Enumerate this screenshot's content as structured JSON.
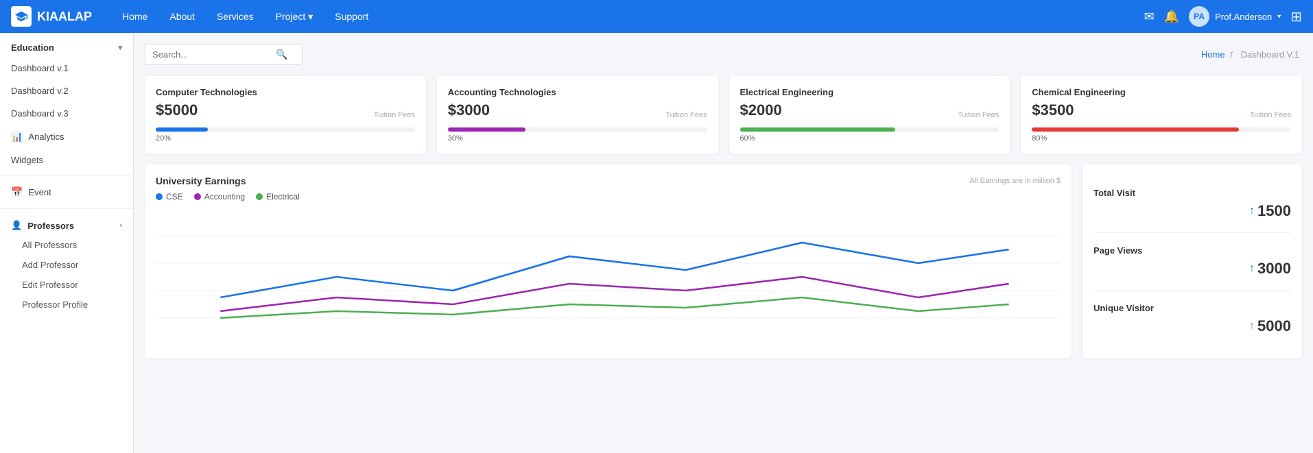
{
  "topnav": {
    "brand": "KIAALAP",
    "links": [
      "Home",
      "About",
      "Services",
      "Project",
      "Support"
    ],
    "project_has_dropdown": true,
    "user_name": "Prof.Anderson",
    "icons": {
      "mail": "✉",
      "bell": "🔔",
      "grid": "⊞"
    }
  },
  "sidebar": {
    "education_label": "Education",
    "items": [
      {
        "label": "Dashboard v.1",
        "active": false
      },
      {
        "label": "Dashboard v.2",
        "active": false
      },
      {
        "label": "Dashboard v.3",
        "active": false
      },
      {
        "label": "Analytics",
        "icon": "📊",
        "active": false
      },
      {
        "label": "Widgets",
        "active": false
      },
      {
        "label": "Event",
        "icon": "📅",
        "active": false
      }
    ],
    "professors_label": "Professors",
    "professor_sub_items": [
      "All Professors",
      "Add Professor",
      "Edit Professor",
      "Professor Profile"
    ]
  },
  "search": {
    "placeholder": "Search...",
    "icon": "🔍"
  },
  "breadcrumb": {
    "home": "Home",
    "current": "Dashboard V.1"
  },
  "stat_cards": [
    {
      "title": "Computer Technologies",
      "amount": "$5000",
      "label": "Tuition Fees",
      "pct": 20,
      "pct_text": "20%",
      "color": "#1a73e8"
    },
    {
      "title": "Accounting Technologies",
      "amount": "$3000",
      "label": "Tuition Fees",
      "pct": 30,
      "pct_text": "30%",
      "color": "#9c27b0"
    },
    {
      "title": "Electrical Engineering",
      "amount": "$2000",
      "label": "Tuition Fees",
      "pct": 60,
      "pct_text": "60%",
      "color": "#4caf50"
    },
    {
      "title": "Chemical Engineering",
      "amount": "$3500",
      "label": "Tuition Fees",
      "pct": 80,
      "pct_text": "80%",
      "color": "#e53935"
    }
  ],
  "earnings": {
    "title": "University Earnings",
    "note": "All Earnings are in million $",
    "legend": [
      {
        "label": "CSE",
        "color": "#1a73e8"
      },
      {
        "label": "Accounting",
        "color": "#9c27b0"
      },
      {
        "label": "Electrical",
        "color": "#4caf50"
      }
    ]
  },
  "total_stats": [
    {
      "label": "Total Visit",
      "value": "1500",
      "arrow": "up-blue"
    },
    {
      "label": "Page Views",
      "value": "3000",
      "arrow": "up-blue"
    },
    {
      "label": "Unique Visitor",
      "value": "5000",
      "arrow": "up-green"
    }
  ]
}
